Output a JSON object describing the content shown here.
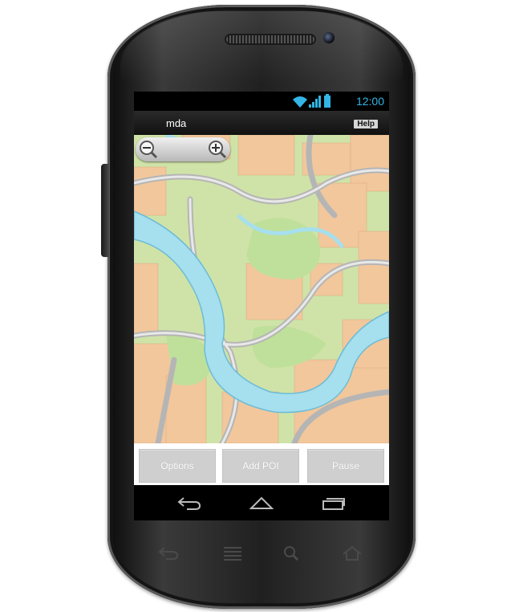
{
  "statusbar": {
    "time": "12:00",
    "wifi_icon": "wifi-icon",
    "signal_icon": "signal-icon",
    "battery_icon": "battery-icon"
  },
  "appbar": {
    "title": "mda",
    "help_label": "Help"
  },
  "map": {
    "zoom_out_icon": "zoom-out-icon",
    "zoom_in_icon": "zoom-in-icon"
  },
  "buttons": {
    "options_label": "Options",
    "add_poi_label": "Add POI",
    "pause_label": "Pause"
  },
  "navbar": {
    "back_icon": "back-icon",
    "home_icon": "home-icon",
    "recents_icon": "recents-icon"
  },
  "hardware_keys": [
    "back-key-icon",
    "menu-key-icon",
    "search-key-icon",
    "home-key-icon"
  ],
  "colors": {
    "accent": "#33b5e5",
    "river": "#a7e1ee",
    "park": "#c9e0a2",
    "buildings": "#f3c9a0",
    "roads": "#b9b9b9"
  }
}
